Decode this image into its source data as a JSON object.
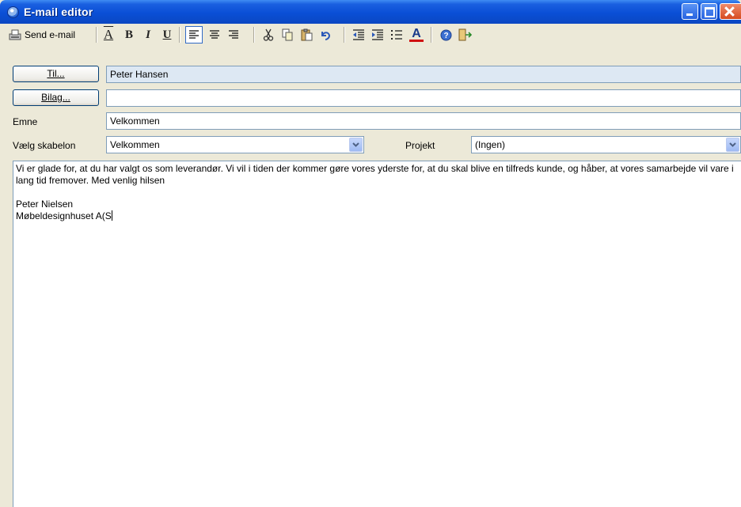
{
  "window": {
    "title": "E-mail editor"
  },
  "toolbar": {
    "send_label": "Send e-mail",
    "buttons": [
      {
        "name": "send-email-icon"
      },
      {
        "name": "font-icon"
      },
      {
        "name": "bold-icon"
      },
      {
        "name": "italic-icon"
      },
      {
        "name": "underline-icon"
      },
      {
        "name": "align-left-icon"
      },
      {
        "name": "align-center-icon"
      },
      {
        "name": "align-right-icon"
      },
      {
        "name": "cut-icon"
      },
      {
        "name": "copy-icon"
      },
      {
        "name": "paste-icon"
      },
      {
        "name": "undo-icon"
      },
      {
        "name": "outdent-icon"
      },
      {
        "name": "indent-icon"
      },
      {
        "name": "bullet-list-icon"
      },
      {
        "name": "font-color-icon"
      },
      {
        "name": "help-icon"
      },
      {
        "name": "exit-icon"
      }
    ],
    "bold_glyph": "B",
    "italic_glyph": "I",
    "underline_glyph": "U",
    "font_glyph": "A",
    "color_glyph": "A",
    "font_color": "#d01010"
  },
  "form": {
    "to_button": "Til...",
    "to_value": "Peter Hansen",
    "attach_button": "Bilag...",
    "attach_value": "",
    "subject_label": "Emne",
    "subject_value": "Velkommen",
    "template_label": "Vælg skabelon",
    "template_value": "Velkommen",
    "project_label": "Projekt",
    "project_value": "(Ingen)"
  },
  "body": {
    "text": "Vi er glade for, at du har valgt os som leverandør. Vi vil i tiden der kommer gøre vores yderste for, at du skal blive en tilfreds kunde, og håber, at vores samarbejde vil vare i lang tid fremover. Med venlig hilsen\n\nPeter Nielsen\nMøbeldesignhuset A(S"
  }
}
